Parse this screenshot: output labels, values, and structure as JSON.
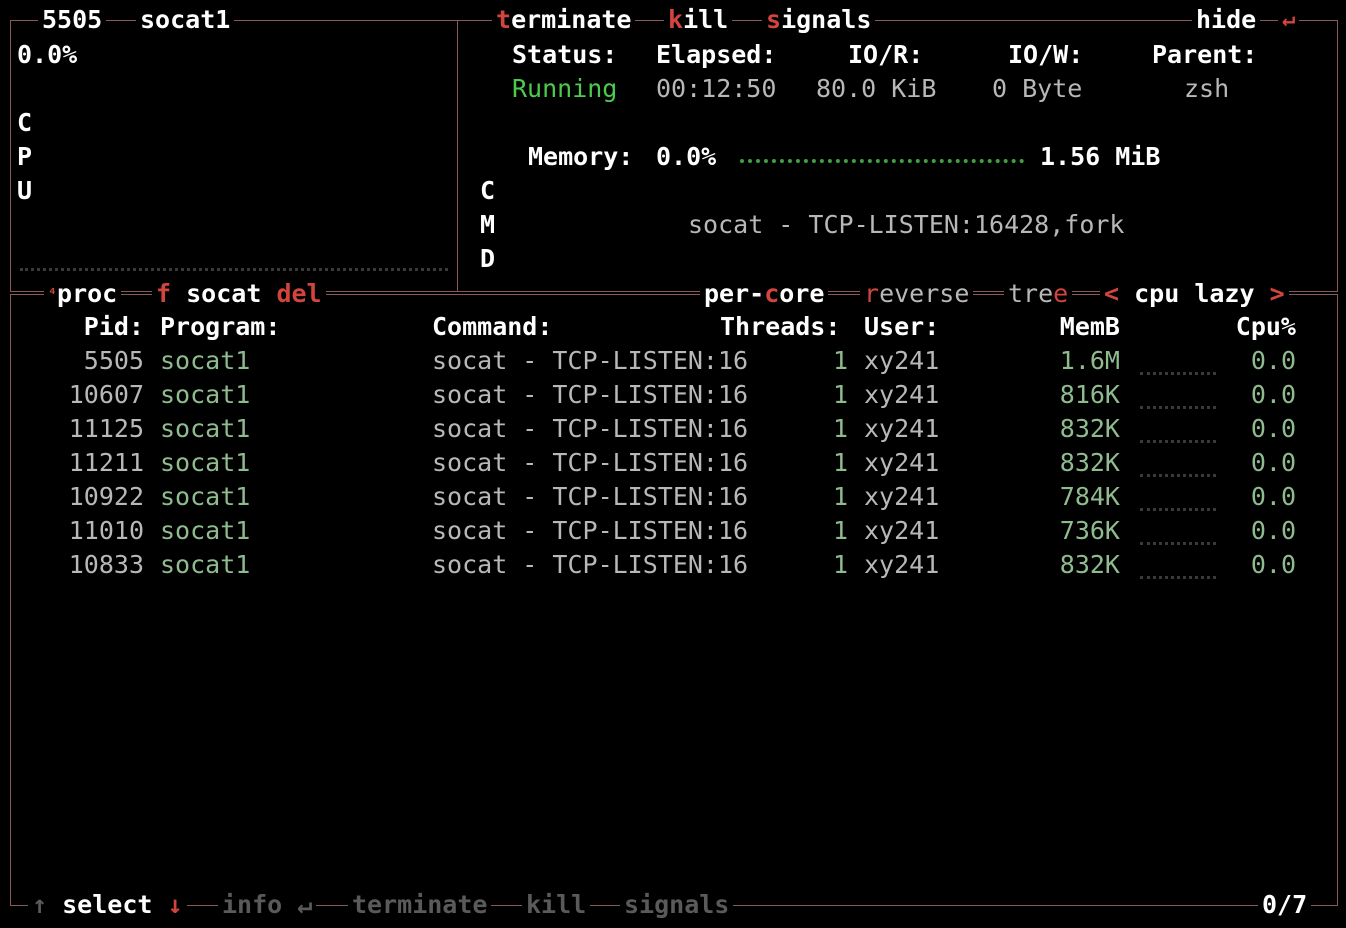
{
  "proc_detail": {
    "pid": "5505",
    "name": "socat1",
    "cpu_percent": "0.0%",
    "cpu_label": [
      "C",
      "P",
      "U"
    ],
    "actions": [
      {
        "hotkey": "t",
        "rest": "erminate"
      },
      {
        "hotkey": "k",
        "rest": "ill"
      },
      {
        "hotkey": "s",
        "rest": "ignals"
      }
    ],
    "hide_label": "hide",
    "hide_icon": "↵",
    "fields": [
      {
        "label": "Status:",
        "value": "Running"
      },
      {
        "label": "Elapsed:",
        "value": "00:12:50"
      },
      {
        "label": "IO/R:",
        "value": "80.0 KiB"
      },
      {
        "label": "IO/W:",
        "value": "0 Byte"
      },
      {
        "label": "Parent:",
        "value": "zsh"
      }
    ],
    "memory_label": "Memory:",
    "memory_percent": "0.0%",
    "memory_size": "1.56 MiB",
    "cmd_label": [
      "C",
      "M",
      "D"
    ],
    "cmd": "socat - TCP-LISTEN:16428,fork"
  },
  "proc_list": {
    "section_superscript": "⁴",
    "section_title": "proc",
    "filter_key": "f",
    "filter_value": "socat",
    "filter_del": "del",
    "options": {
      "per_core_a": "per-",
      "per_core_key": "c",
      "per_core_b": "ore",
      "reverse_key": "r",
      "reverse_rest": "everse",
      "tree_a": "tre",
      "tree_key": "e",
      "sort_left": "<",
      "sort_value": "cpu lazy",
      "sort_right": ">"
    },
    "columns": {
      "pid": "Pid:",
      "program": "Program:",
      "command": "Command:",
      "threads": "Threads:",
      "user": "User:",
      "memb": "MemB",
      "cpu": "Cpu%"
    },
    "rows": [
      {
        "pid": "5505",
        "program": "socat1",
        "command": "socat - TCP-LISTEN:16",
        "threads": "1",
        "user": "xy241",
        "mem": "1.6M",
        "cpu": "0.0"
      },
      {
        "pid": "10607",
        "program": "socat1",
        "command": "socat - TCP-LISTEN:16",
        "threads": "1",
        "user": "xy241",
        "mem": "816K",
        "cpu": "0.0"
      },
      {
        "pid": "11125",
        "program": "socat1",
        "command": "socat - TCP-LISTEN:16",
        "threads": "1",
        "user": "xy241",
        "mem": "832K",
        "cpu": "0.0"
      },
      {
        "pid": "11211",
        "program": "socat1",
        "command": "socat - TCP-LISTEN:16",
        "threads": "1",
        "user": "xy241",
        "mem": "832K",
        "cpu": "0.0"
      },
      {
        "pid": "10922",
        "program": "socat1",
        "command": "socat - TCP-LISTEN:16",
        "threads": "1",
        "user": "xy241",
        "mem": "784K",
        "cpu": "0.0"
      },
      {
        "pid": "11010",
        "program": "socat1",
        "command": "socat - TCP-LISTEN:16",
        "threads": "1",
        "user": "xy241",
        "mem": "736K",
        "cpu": "0.0"
      },
      {
        "pid": "10833",
        "program": "socat1",
        "command": "socat - TCP-LISTEN:16",
        "threads": "1",
        "user": "xy241",
        "mem": "832K",
        "cpu": "0.0"
      }
    ],
    "footer": {
      "up_arrow": "↑",
      "select": "select",
      "down_arrow": "↓",
      "info": "info",
      "enter_icon": "↵",
      "terminate": "terminate",
      "kill": "kill",
      "signals": "signals",
      "count": "0/7"
    }
  },
  "colors": {
    "border": "#8a5a5a",
    "hotkey": "#d2453e",
    "running": "#4ccb4c",
    "program": "#8fbc8f"
  }
}
